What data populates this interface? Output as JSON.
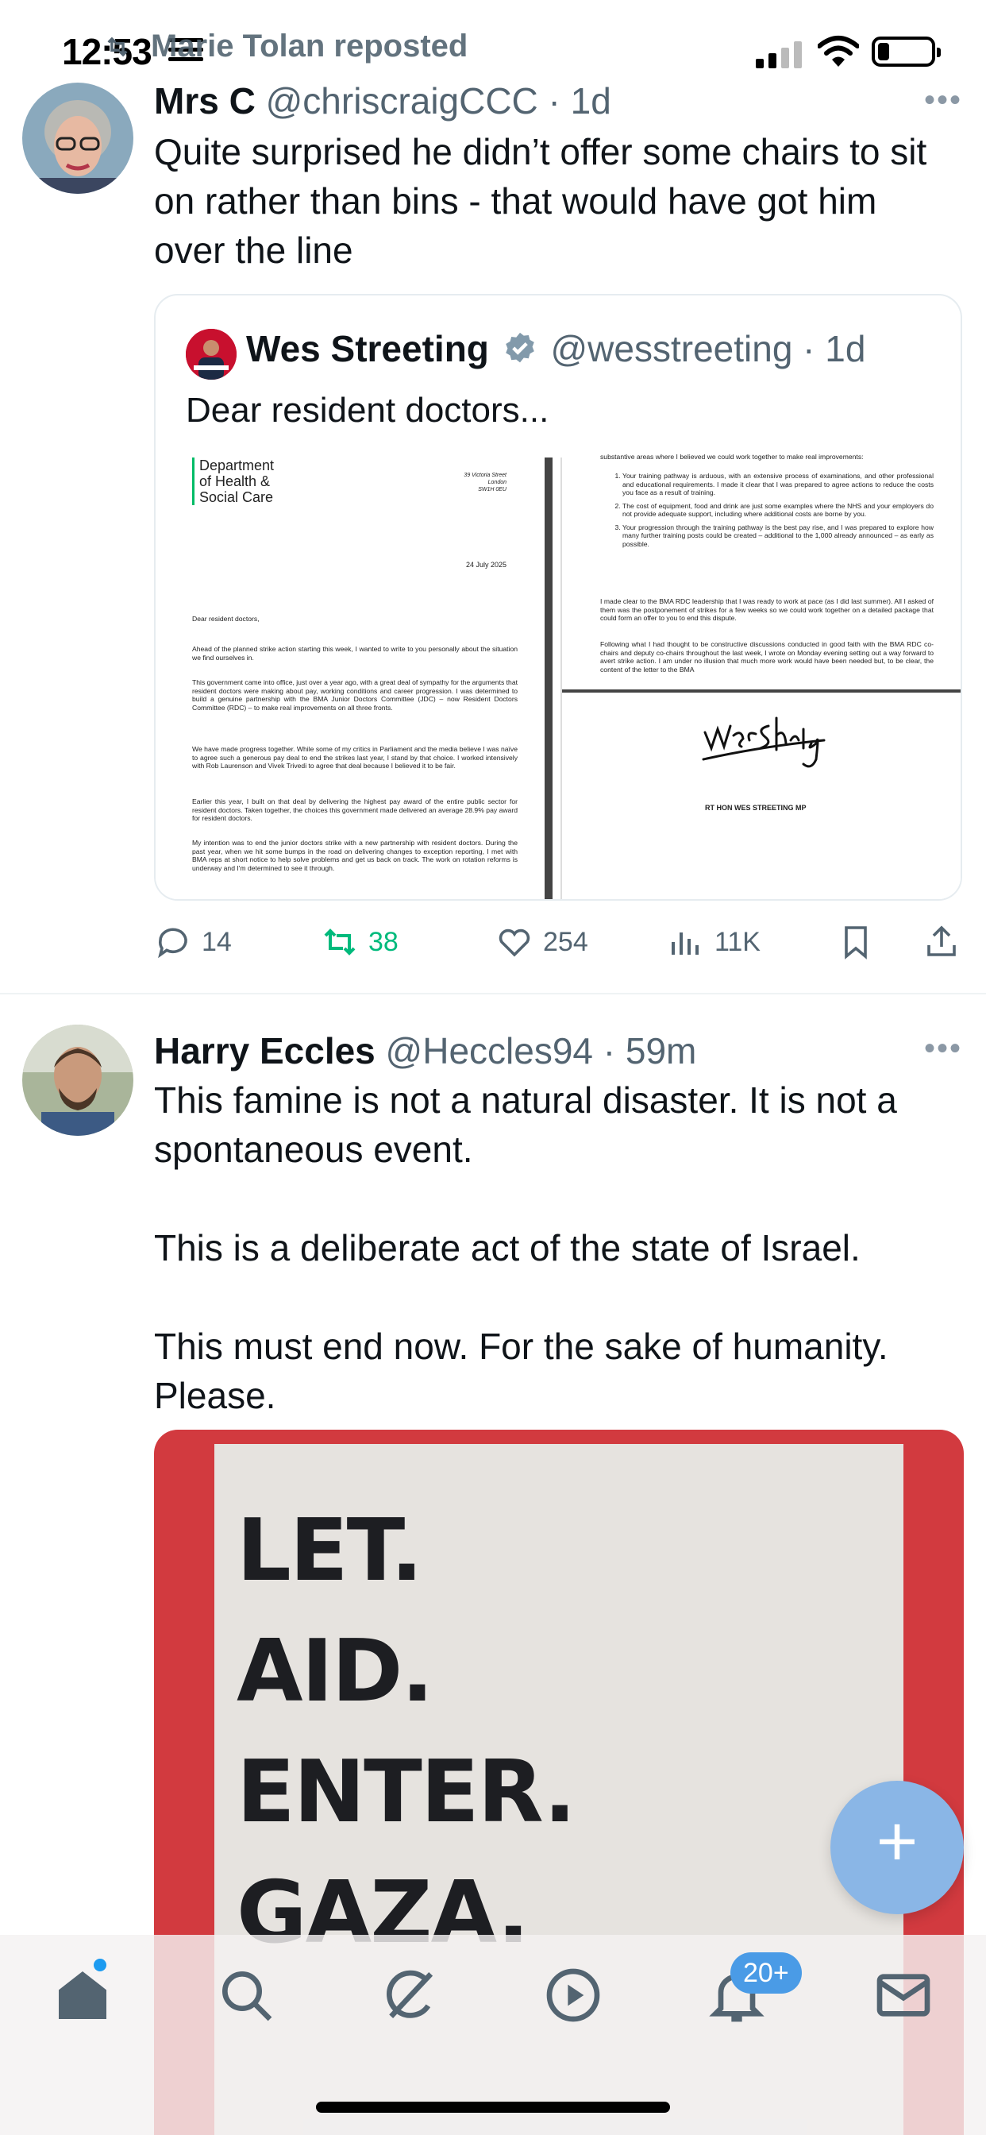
{
  "status_bar": {
    "time": "12:53"
  },
  "repost_banner": {
    "text": "Marie Tolan reposted"
  },
  "tweet1": {
    "name": "Mrs C",
    "handle": "@chriscraigCCC · 1d",
    "text": "Quite surprised he didn’t offer some chairs to sit on rather than bins - that would have got him over the line",
    "quote": {
      "name": "Wes Streeting",
      "handle": "@wesstreeting · 1d",
      "text": "Dear resident doctors...",
      "letter": {
        "dept": "Department\nof Health &\nSocial Care",
        "address": "39 Victoria Street\nLondon\nSW1H 0EU",
        "date": "24 July 2025",
        "greeting": "Dear resident doctors,",
        "p1": "Ahead of the planned strike action starting this week, I wanted to write to you personally about the situation we find ourselves in.",
        "p2": "This government came into office, just over a year ago, with a great deal of sympathy for the arguments that resident doctors were making about pay, working conditions and career progression. I was determined to build a genuine partnership with the BMA Junior Doctors Committee (JDC) – now Resident Doctors Committee (RDC) – to make real improvements on all three fronts.",
        "p3": "We have made progress together. While some of my critics in Parliament and the media believe I was naïve to agree such a generous pay deal to end the strikes last year, I stand by that choice. I worked intensively with Rob Laurenson and Vivek Trivedi to agree that deal because I believed it to be fair.",
        "p4": "Earlier this year, I built on that deal by delivering the highest pay award of the entire public sector for resident doctors. Taken together, the choices this government made delivered an average 28.9% pay award for resident doctors.",
        "p5": "My intention was to end the junior doctors strike with a new partnership with resident doctors. During the past year, when we hit some bumps in the road on delivering changes to exception reporting, I met with BMA reps at short notice to help solve problems and get us back on track. The work on rotation reforms is underway and I'm determined to see it through.",
        "r0": "substantive areas where I believed we could work together to make real improvements:",
        "r1": "Your training pathway is arduous, with an extensive process of examinations, and other professional and educational requirements. I made it clear that I was prepared to agree actions to reduce the costs you face as a result of training.",
        "r2": "The cost of equipment, food and drink are just some examples where the NHS and your employers do not provide adequate support, including where additional costs are borne by you.",
        "r3": "Your progression through the training pathway is the best pay rise, and I was prepared to explore how many further training posts could be created – additional to the 1,000 already announced – as early as possible.",
        "r4": "I made clear to the BMA RDC leadership that I was ready to work at pace (as I did last summer). All I asked of them was the postponement of strikes for a few weeks so we could work together on a detailed package that could form an offer to you to end this dispute.",
        "r5": "Following what I had thought to be constructive discussions conducted in good faith with the BMA RDC co-chairs and deputy co-chairs throughout the last week, I wrote on Monday evening setting out a way forward to avert strike action. I am under no illusion that much more work would have been needed but, to be clear, the content of the letter to the BMA",
        "signature": "Wes Streeting",
        "signoff": "RT HON WES STREETING MP"
      }
    },
    "actions": {
      "replies": "14",
      "reposts": "38",
      "likes": "254",
      "views": "11K"
    }
  },
  "tweet2": {
    "name": "Harry Eccles",
    "handle": "@Heccles94 · 59m",
    "text": "This famine is not a natural disaster. It is not a spontaneous event.\n\nThis is a deliberate act of the state of Israel.\n\nThis must end now. For the sake of humanity. Please.",
    "poster": {
      "line1": "LET.",
      "line2": "AID.",
      "line3": "ENTER.",
      "line4": "GAZA."
    }
  },
  "tabbar": {
    "notifications_badge": "20+"
  },
  "colors": {
    "accent": "#1d9bf0",
    "repost_green": "#00ba7c",
    "muted": "#536471",
    "poster_red": "#d23a3f"
  },
  "icons": [
    "home-icon",
    "search-icon",
    "grok-icon",
    "video-icon",
    "notifications-icon",
    "messages-icon",
    "reply-icon",
    "repost-icon",
    "like-icon",
    "views-icon",
    "bookmark-icon",
    "share-icon",
    "compose-icon"
  ]
}
